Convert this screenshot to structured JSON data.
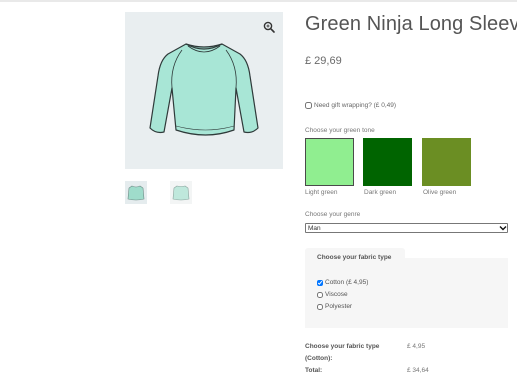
{
  "product": {
    "title": "Green Ninja Long Sleeve",
    "price": "£ 29,69"
  },
  "gallery": {
    "zoom_icon": "magnifier-icon",
    "thumbnails": [
      "thumbnail-front",
      "thumbnail-back"
    ]
  },
  "gift": {
    "label": "Need gift wrapping? (£ 0,49)",
    "checked": false
  },
  "green_tone": {
    "label": "Choose your green tone",
    "options": [
      {
        "label": "Light green",
        "color": "#90ee90",
        "selected": true
      },
      {
        "label": "Dark green",
        "color": "#006400",
        "selected": false
      },
      {
        "label": "Olive green",
        "color": "#6b8e23",
        "selected": false
      }
    ]
  },
  "genre": {
    "label": "Choose your genre",
    "value": "Man"
  },
  "fabric": {
    "legend": "Choose your fabric type",
    "options": [
      {
        "label": "Cotton (£ 4,95)",
        "checked": true
      },
      {
        "label": "Viscose",
        "checked": false
      },
      {
        "label": "Polyester",
        "checked": false
      }
    ]
  },
  "totals": {
    "fabric_label_line1": "Choose your fabric type",
    "fabric_label_line2": "(Cotton):",
    "fabric_value": "£ 4,95",
    "total_label": "Total:",
    "total_value": "£ 34,64"
  }
}
